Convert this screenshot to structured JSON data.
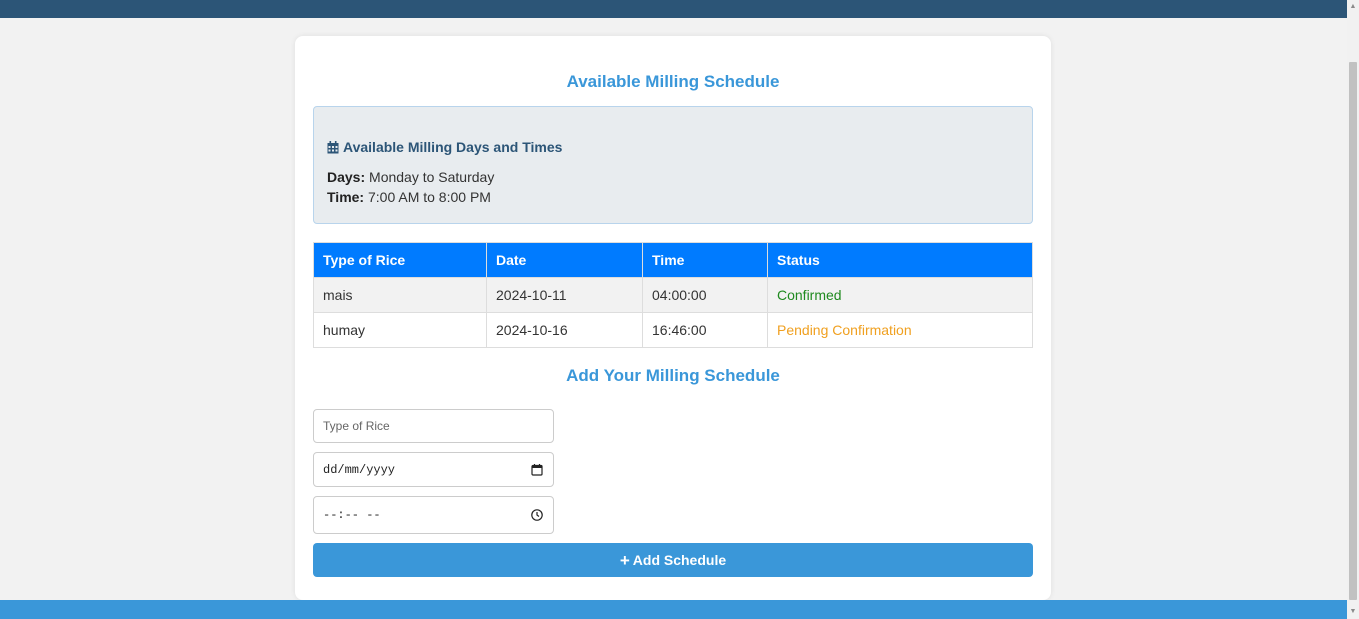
{
  "header": {
    "title": "Available Milling Schedule"
  },
  "availability": {
    "heading": "Available Milling Days and Times",
    "icon": "calendar-icon",
    "days_label": "Days:",
    "days_value": "Monday to Saturday",
    "time_label": "Time:",
    "time_value": "7:00 AM to 8:00 PM"
  },
  "table": {
    "columns": [
      "Type of Rice",
      "Date",
      "Time",
      "Status"
    ],
    "rows": [
      {
        "type": "mais",
        "date": "2024-10-11",
        "time": "04:00:00",
        "status": "Confirmed",
        "status_color": "#1f8a1f"
      },
      {
        "type": "humay",
        "date": "2024-10-16",
        "time": "16:46:00",
        "status": "Pending Confirmation",
        "status_color": "#f0a020"
      }
    ]
  },
  "form": {
    "title": "Add Your Milling Schedule",
    "rice_placeholder": "Type of Rice",
    "date_placeholder": "dd/mm/yyyy",
    "time_placeholder": "--:-- --",
    "submit_label": "Add Schedule",
    "submit_icon": "plus-icon"
  },
  "colors": {
    "accent": "#3a97d9",
    "table_header": "#007bff",
    "nav": "#2c5577"
  }
}
